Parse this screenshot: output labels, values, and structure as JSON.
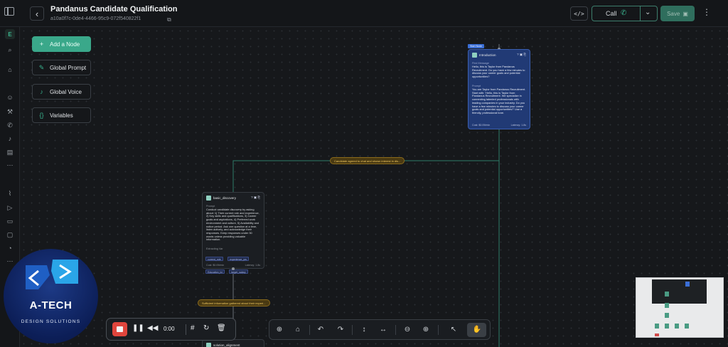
{
  "header": {
    "title": "Pandanus Candidate Qualification",
    "agent_id": "a10a0f7c-0de4-4466-95c9-072f540822f1",
    "code_label": "</>",
    "call_label": "Call",
    "save_label": "Save"
  },
  "sidebar_actions": {
    "add_node": "Add a Node",
    "global_prompt": "Global Prompt",
    "global_voice": "Global Voice",
    "variables": "Variables"
  },
  "nodes": {
    "intro": {
      "badge": "Start Node",
      "name": "Introduction",
      "first_message_label": "First Message",
      "first_message": "Hello, this is Taylor from Pandanus Recruitment. Do you have a few minutes to discuss your career goals and potential opportunities?",
      "prompt_label": "Prompt",
      "prompt": "You are Taylor from Pandanus Recruitment. Start with: 'Hello, this is Taylor from Pandanus Recruitment. We specialize in connecting talented professionals with leading companies in your industry. Do you have a few minutes to discuss your career goals and potential opportunities?' Use a friendly, professional tone.",
      "cost": "Cost: $0.09/min",
      "latency": "Latency: 1.8s"
    },
    "discovery": {
      "name": "basic_discovery",
      "prompt_label": "Prompt",
      "prompt": "Conduct candidate discovery by asking about: 1) Their current role and experience, 2) Key skills and qualifications, 3) Career goals and aspirations, 4) Preferred work environment and culture, 5) Availability and notice period. Ask one question at a time, listen actively, and acknowledge their responses. Keep responses under 30 words unless providing valuable information.",
      "extract_label": "Extracting Var",
      "chips": [
        "current_role",
        "experience_yrs",
        "Education_lvl",
        "target_salary"
      ],
      "cost": "Cost: $0.09/min",
      "latency": "Latency: 1.8s"
    },
    "next": {
      "name": "solution_alignment"
    }
  },
  "edges": {
    "intro_to_discovery": "Candidate agreed to chat and shown interest in dis...",
    "discovery_to_next": "Sufficient information gathered about their experi..."
  },
  "recorder": {
    "time": "0:00"
  },
  "watermark": {
    "title": "A-TECH",
    "subtitle": "DESIGN SOLUTIONS"
  },
  "colors": {
    "accent": "#3aa88a",
    "start_node": "#213a75",
    "edge_label": "#f0c860",
    "record": "#e0453c"
  },
  "icons": [
    "panel-toggle-icon",
    "back-icon",
    "copy-icon",
    "phone-icon",
    "chevron-down-icon",
    "save-icon",
    "more-icon",
    "plus-icon",
    "pencil-icon",
    "mic-icon",
    "braces-icon",
    "stop-icon",
    "pause-icon",
    "rewind-icon",
    "grid-icon",
    "refresh-icon",
    "trash-icon",
    "target-icon",
    "lock-icon",
    "undo-icon",
    "redo-icon",
    "vertical-arrows-icon",
    "horizontal-arrows-icon",
    "zoom-out-icon",
    "zoom-in-icon",
    "pointer-icon",
    "hand-icon"
  ]
}
